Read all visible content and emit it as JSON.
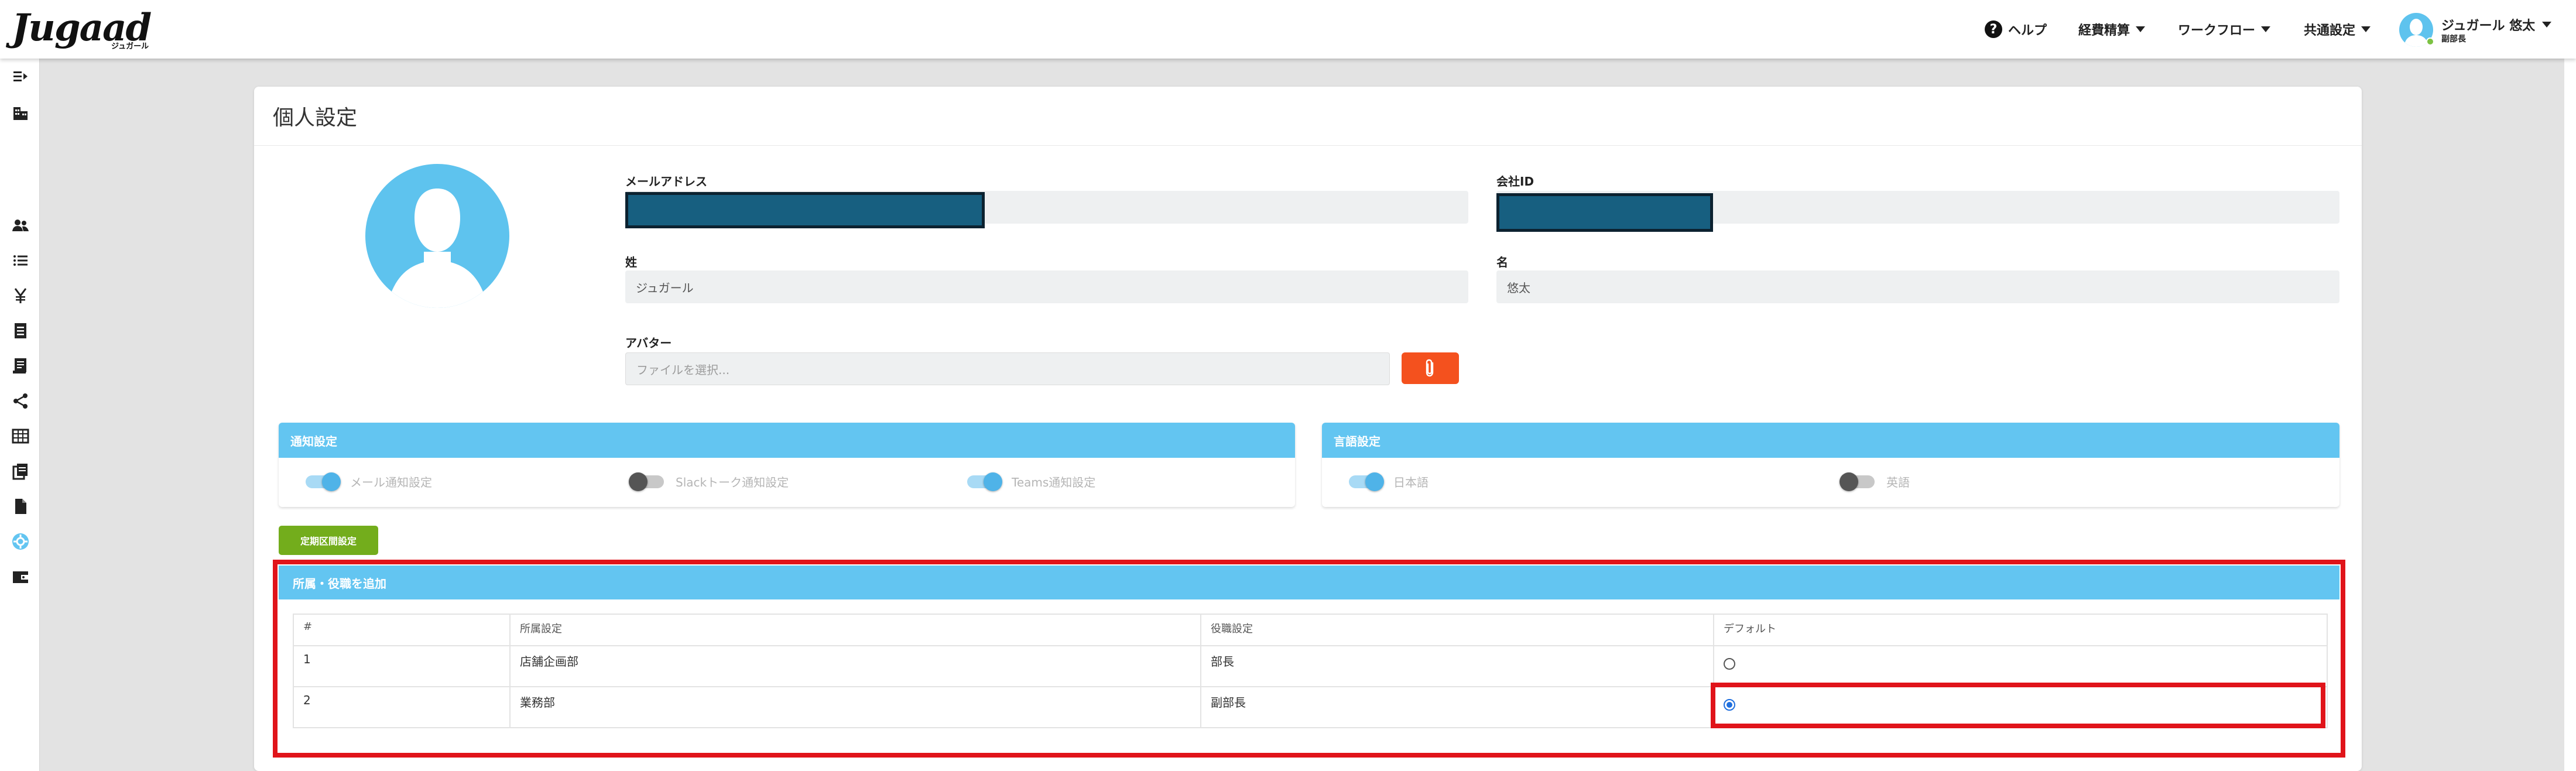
{
  "header": {
    "logo": "Jugaad",
    "logo_sub": "ジュガール",
    "help_label": "ヘルプ",
    "nav": [
      "経費精算",
      "ワークフロー",
      "共通設定"
    ],
    "user_name": "ジュガール 悠太",
    "user_role": "副部長"
  },
  "page": {
    "title": "個人設定"
  },
  "profile": {
    "email_label": "メールアドレス",
    "company_id_label": "会社ID",
    "last_name_label": "姓",
    "last_name_value": "ジュガール",
    "first_name_label": "名",
    "first_name_value": "悠太",
    "avatar_label": "アバター",
    "avatar_placeholder": "ファイルを選択..."
  },
  "notification": {
    "title": "通知設定",
    "toggles": [
      {
        "label": "メール通知設定",
        "on": true
      },
      {
        "label": "Slackトーク通知設定",
        "on": false
      },
      {
        "label": "Teams通知設定",
        "on": true
      }
    ]
  },
  "language": {
    "title": "言語設定",
    "toggles": [
      {
        "label": "日本語",
        "on": true
      },
      {
        "label": "英語",
        "on": false
      }
    ]
  },
  "schedule_button": "定期区間設定",
  "affiliation": {
    "title": "所属・役職を追加",
    "columns": [
      "#",
      "所属設定",
      "役職設定",
      "デフォルト"
    ],
    "rows": [
      {
        "no": "1",
        "dept": "店舗企画部",
        "position": "部長",
        "default": false
      },
      {
        "no": "2",
        "dept": "業務部",
        "position": "副部長",
        "default": true
      }
    ]
  },
  "colors": {
    "accent": "#63c5f1",
    "highlight": "#e0141a",
    "file_button": "#f4511e",
    "green_button": "#73ad1c"
  }
}
